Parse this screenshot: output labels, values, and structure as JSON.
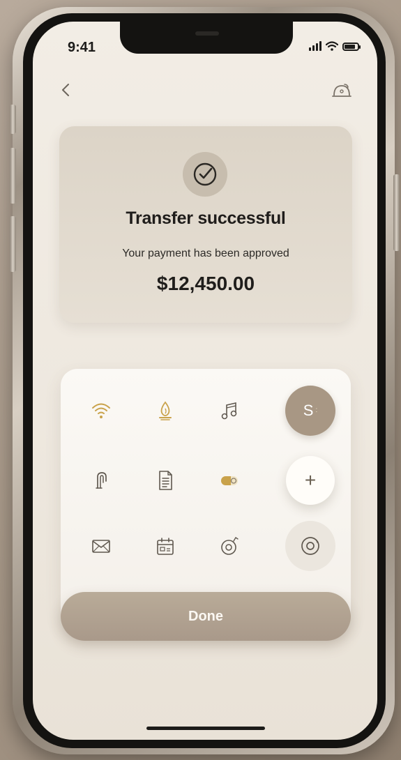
{
  "status_bar": {
    "time": "9:41"
  },
  "success": {
    "title": "Transfer successful",
    "subtitle": "Your payment has been approved",
    "amount": "$12,450.00"
  },
  "grid": {
    "s_button_label": "S",
    "add_button_label": "+",
    "icons": [
      "wifi-icon",
      "drop-lamp-icon",
      "music-notes-icon",
      "s-button",
      "hook-icon",
      "document-icon",
      "toggle-icon",
      "add-button",
      "mail-icon",
      "calendar-icon",
      "disc-icon",
      "lens-button"
    ]
  },
  "actions": {
    "done_label": "Done"
  },
  "colors": {
    "accent_taupe": "#a89784",
    "gold": "#c9a24a",
    "screen_bg": "#efe9e0",
    "card_bg": "#ded6c9"
  }
}
